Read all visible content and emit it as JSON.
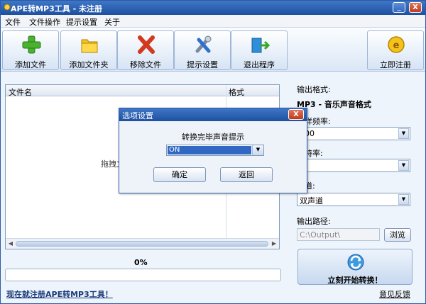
{
  "window": {
    "title": "APE转MP3工具 - 未注册",
    "min": "_",
    "close": "X"
  },
  "menu": [
    "文件",
    "文件操作",
    "提示设置",
    "关于"
  ],
  "toolbar": {
    "add_file": "添加文件",
    "add_folder": "添加文件夹",
    "remove_file": "移除文件",
    "prompt_settings": "提示设置",
    "exit": "退出程序",
    "register": "立即注册"
  },
  "filelist": {
    "col_name": "文件名",
    "col_format": "格式",
    "hint": "拖拽文"
  },
  "progress": {
    "percent_text": "0%",
    "value": 0
  },
  "register_link": "现在就注册APE转MP3工具！",
  "settings": {
    "output_format_label": "输出格式:",
    "output_format_value": "MP3 - 音乐声音格式",
    "sample_rate_label": "采样频率:",
    "sample_rate_value": "000",
    "bitrate_label": "比特率:",
    "bitrate_value": "0",
    "channel_label": "声道:",
    "channel_value": "双声道",
    "output_path_label": "输出路径:",
    "output_path_value": "C:\\Output\\",
    "browse": "浏览"
  },
  "start_button": "立刻开始转换！",
  "feedback_link": "意见反馈",
  "dialog": {
    "title": "选项设置",
    "close": "X",
    "prompt": "转换完毕声音提示",
    "select_value": "ON",
    "ok": "确定",
    "back": "返回"
  }
}
